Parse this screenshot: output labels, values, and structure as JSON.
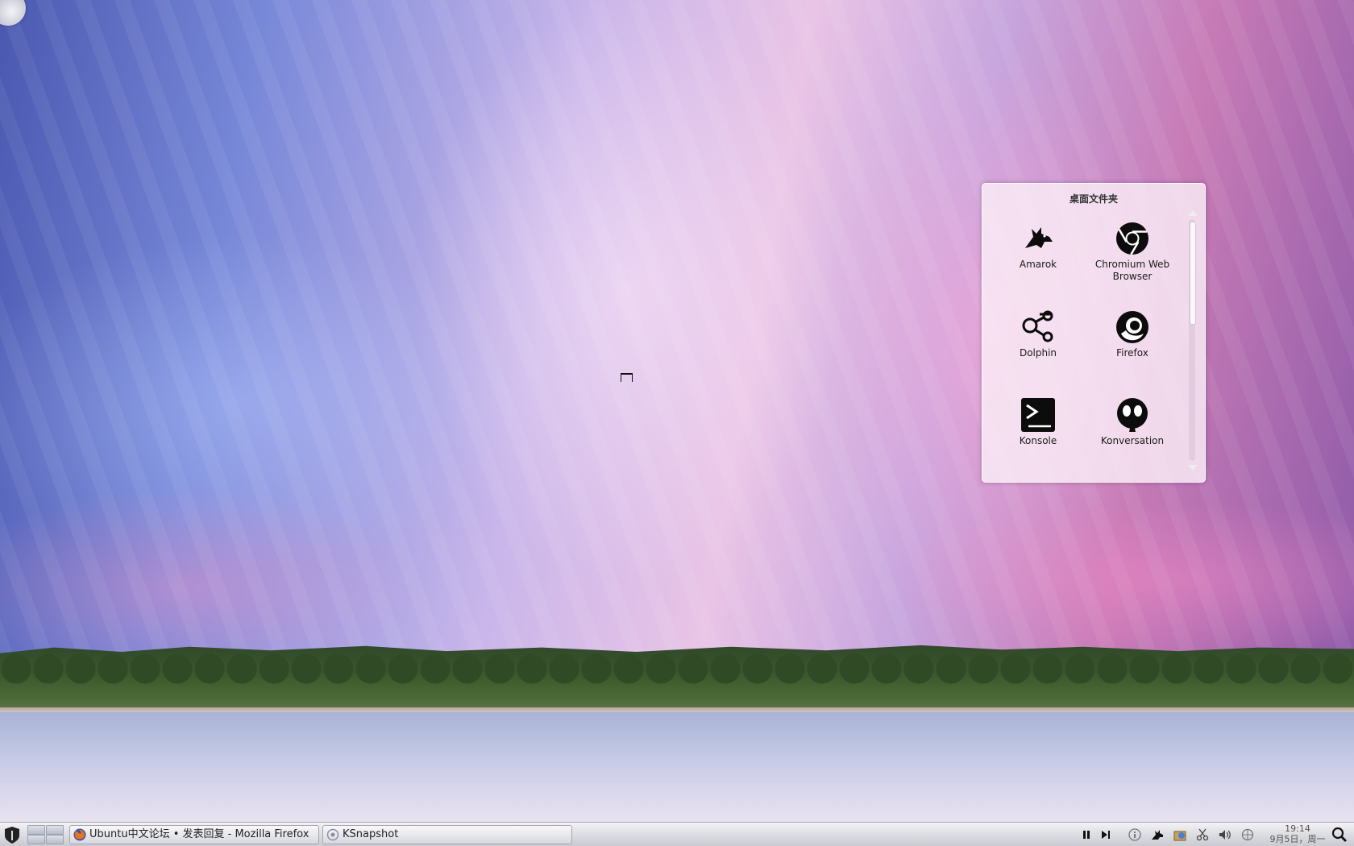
{
  "desktop": {
    "folder_view": {
      "title": "桌面文件夹",
      "items": [
        {
          "label": "Amarok",
          "icon": "amarok-wolf-icon"
        },
        {
          "label": "Chromium Web Browser",
          "icon": "chromium-icon"
        },
        {
          "label": "Dolphin",
          "icon": "dolphin-file-manager-icon"
        },
        {
          "label": "Firefox",
          "icon": "firefox-icon"
        },
        {
          "label": "Konsole",
          "icon": "konsole-terminal-icon"
        },
        {
          "label": "Konversation",
          "icon": "konversation-icon"
        }
      ]
    }
  },
  "taskbar": {
    "tasks": [
      {
        "label": "Ubuntu中文论坛 • 发表回复 - Mozilla Firefox",
        "icon": "firefox-icon"
      },
      {
        "label": "KSnapshot",
        "icon": "ksnapshot-icon"
      }
    ],
    "tray": [
      "play-pause-icon",
      "next-track-icon",
      "info-icon",
      "amarok-wolf-icon",
      "package-updates-icon",
      "klipper-scissors-icon",
      "volume-icon",
      "network-icon"
    ],
    "clock": {
      "time": "19:14",
      "date": "9月5日，周一"
    }
  }
}
